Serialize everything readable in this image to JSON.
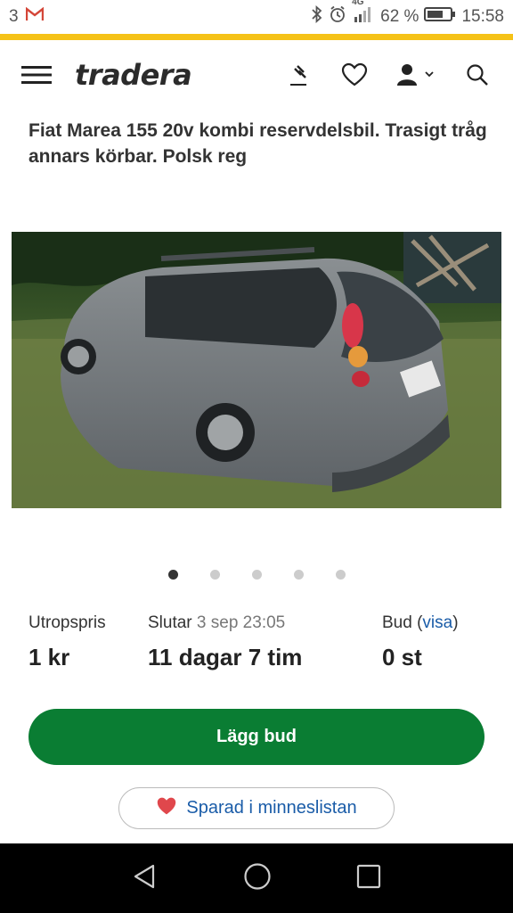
{
  "status_bar": {
    "notification_count": "3",
    "mail_icon": "gmail-icon",
    "network": "4G",
    "battery_percent": "62 %",
    "time": "15:58"
  },
  "header": {
    "logo": "tradera",
    "icons": [
      "menu-icon",
      "auction-hammer-icon",
      "heart-icon",
      "user-icon",
      "search-icon"
    ]
  },
  "listing": {
    "title": "Fiat Marea 155 20v kombi reservdelsbil. Trasigt tråg annars körbar. Polsk reg",
    "image_count": 5,
    "active_image": 1
  },
  "info": {
    "start_price_label": "Utropspris",
    "start_price_value": "1 kr",
    "ends_label": "Slutar",
    "ends_date": "3 sep 23:05",
    "ends_value": "11 dagar 7 tim",
    "bids_label": "Bud",
    "bids_paren_open": "(",
    "bids_link": "visa",
    "bids_paren_close": ")",
    "bids_value": "0 st"
  },
  "actions": {
    "bid_label": "Lägg bud",
    "saved_label": "Sparad i minneslistan"
  },
  "colors": {
    "accent_yellow": "#f5c218",
    "bid_green": "#0a7d33",
    "link_blue": "#1a5ca8",
    "heart_red": "#e0474c"
  }
}
